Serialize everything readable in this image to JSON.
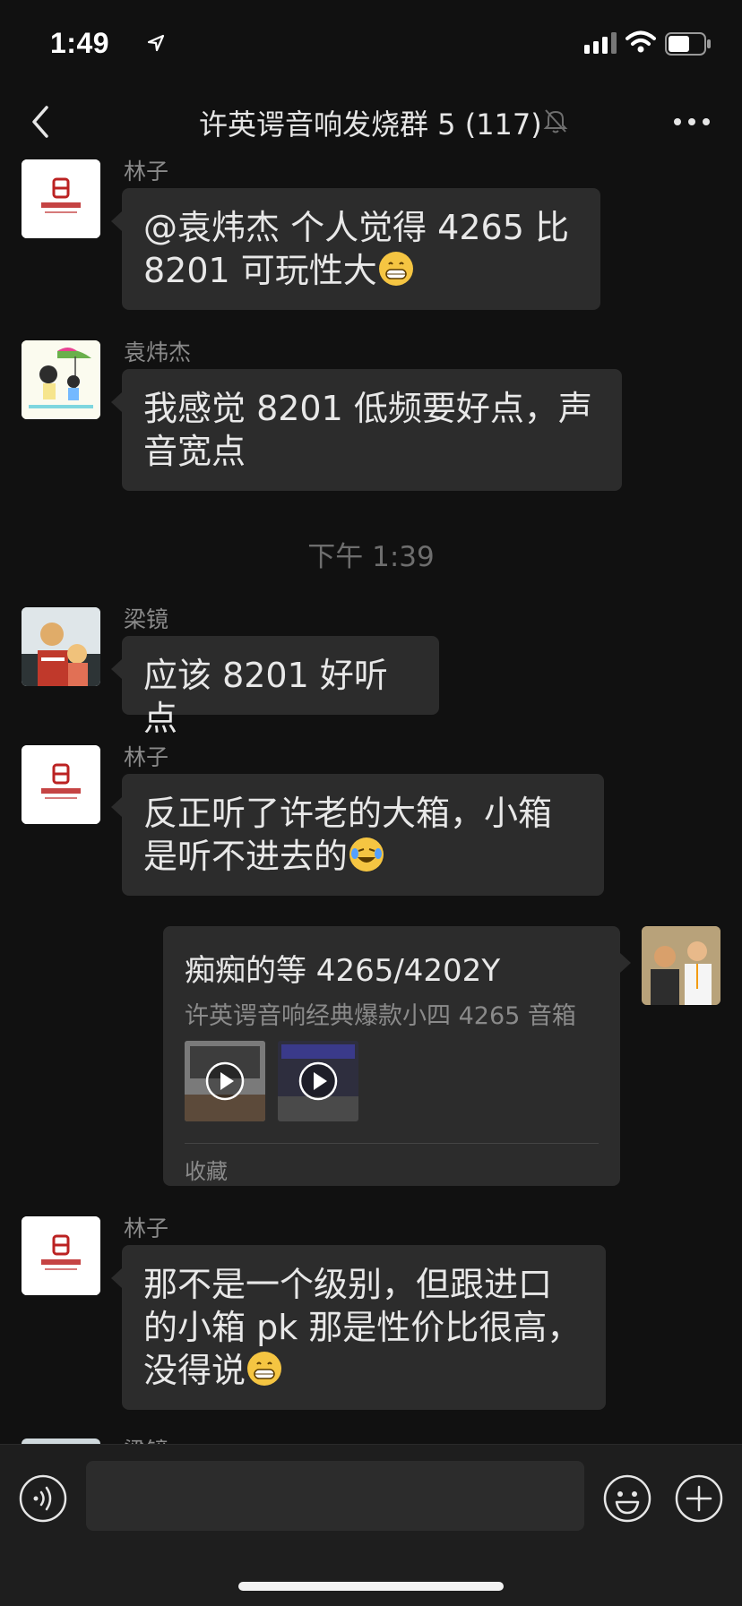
{
  "status_bar": {
    "time": "1:49",
    "battery_level": 0.6
  },
  "nav": {
    "title": "许英谔音响发烧群 5 (117)"
  },
  "messages": [
    {
      "sender": "林子",
      "lines": [
        "@袁炜杰 个人觉得 4265 比",
        "8201 可玩性大"
      ],
      "trailing_emoji": "grin-emoji"
    },
    {
      "sender": "袁炜杰",
      "lines": [
        "我感觉 8201 低频要好点，声",
        "音宽点"
      ]
    },
    {
      "sender": "梁镜",
      "lines": [
        "应该 8201 好听点"
      ]
    },
    {
      "sender": "林子",
      "lines": [
        "反正听了许老的大箱，小箱",
        "是听不进去的"
      ],
      "trailing_emoji": "laugh-cry-emoji"
    },
    {
      "sender": "林子",
      "lines": [
        "那不是一个级别，但跟进口",
        "的小箱 pk 那是性价比很高，",
        "没得说"
      ],
      "trailing_emoji": "grin-emoji"
    }
  ],
  "time_separator": "下午 1:39",
  "card": {
    "title": "痴痴的等 4265/4202Y",
    "desc": "许英谔音响经典爆款小四 4265 音箱",
    "source": "收藏"
  },
  "partial_sender": "梁镜",
  "input": {
    "placeholder": ""
  }
}
